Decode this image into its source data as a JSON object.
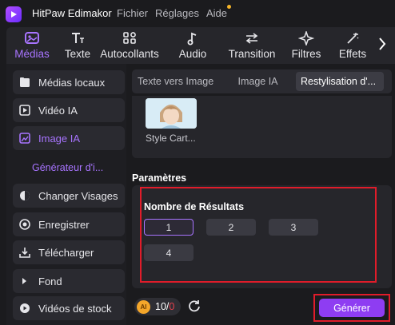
{
  "app": {
    "name": "HitPaw Edimakor",
    "menu": [
      "Fichier",
      "Réglages",
      "Aide"
    ]
  },
  "toolbar": {
    "tools": [
      {
        "label": "Médias",
        "icon": "media-icon",
        "active": true
      },
      {
        "label": "Texte",
        "icon": "text-icon"
      },
      {
        "label": "Autocollants",
        "icon": "stickers-icon"
      },
      {
        "label": "Audio",
        "icon": "music-note-icon"
      },
      {
        "label": "Transition",
        "icon": "transition-arrows-icon"
      },
      {
        "label": "Filtres",
        "icon": "sparkle-icon"
      },
      {
        "label": "Effets",
        "icon": "magic-wand-icon"
      }
    ]
  },
  "sidebar": {
    "items": [
      {
        "label": "Médias locaux",
        "icon": "folder-icon"
      },
      {
        "label": "Vidéo IA",
        "icon": "ai-video-icon"
      },
      {
        "label": "Image IA",
        "icon": "ai-image-icon",
        "active": true
      },
      {
        "label": "Changer Visages",
        "icon": "face-swap-icon"
      },
      {
        "label": "Enregistrer",
        "icon": "record-icon"
      },
      {
        "label": "Télécharger",
        "icon": "download-icon"
      },
      {
        "label": "Fond",
        "icon": "triangle-right-icon"
      },
      {
        "label": "Vidéos de stock",
        "icon": "play-circle-icon"
      }
    ],
    "sub_item": "Générateur d'i..."
  },
  "tabs": [
    "Texte vers Image",
    "Image IA",
    "Restylisation d'..."
  ],
  "style": {
    "label": "Style Cart..."
  },
  "params": {
    "title": "Paramètres",
    "results_title": "Nombre de Résultats",
    "options": [
      "1",
      "2",
      "3",
      "4"
    ],
    "selected": "1"
  },
  "footer": {
    "credits_used": "10",
    "credits_sep": "/",
    "credits_total": "0",
    "coin_label": "AI",
    "generate_label": "Générer"
  },
  "colors": {
    "accent": "#a874ff",
    "button": "#8e3df2",
    "highlight": "#e01c2a"
  }
}
